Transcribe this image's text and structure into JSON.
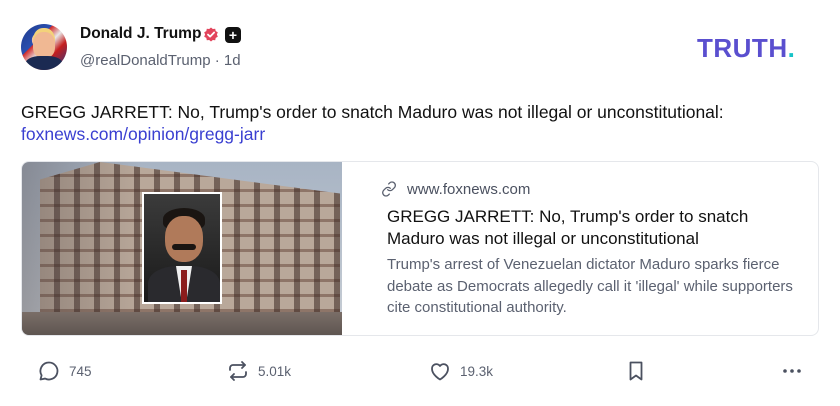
{
  "post": {
    "author": {
      "name": "Donald J. Trump",
      "handle": "@realDonaldTrump",
      "time": "· 1d",
      "plus_badge": "+"
    },
    "brand": {
      "text": "TRUTH",
      "dot": "."
    },
    "text": "GREGG JARRETT: No, Trump's order to snatch Maduro was not illegal or unconstitutional:",
    "link": "foxnews.com/opinion/gregg-jarr",
    "card": {
      "domain": "www.foxnews.com",
      "title": "GREGG JARRETT: No, Trump's order to snatch Maduro was not illegal or unconstitutional",
      "description": "Trump's arrest of Venezuelan dictator Maduro sparks fierce debate as Democrats allegedly call it 'illegal' while supporters cite constitutional authority."
    },
    "actions": {
      "replies": "745",
      "retruths": "5.01k",
      "likes": "19.3k"
    }
  },
  "colors": {
    "brand": "#5a4fcf",
    "brand_dot": "#17c3c7",
    "link": "#3a3fd1",
    "verified": "#e2445c"
  }
}
